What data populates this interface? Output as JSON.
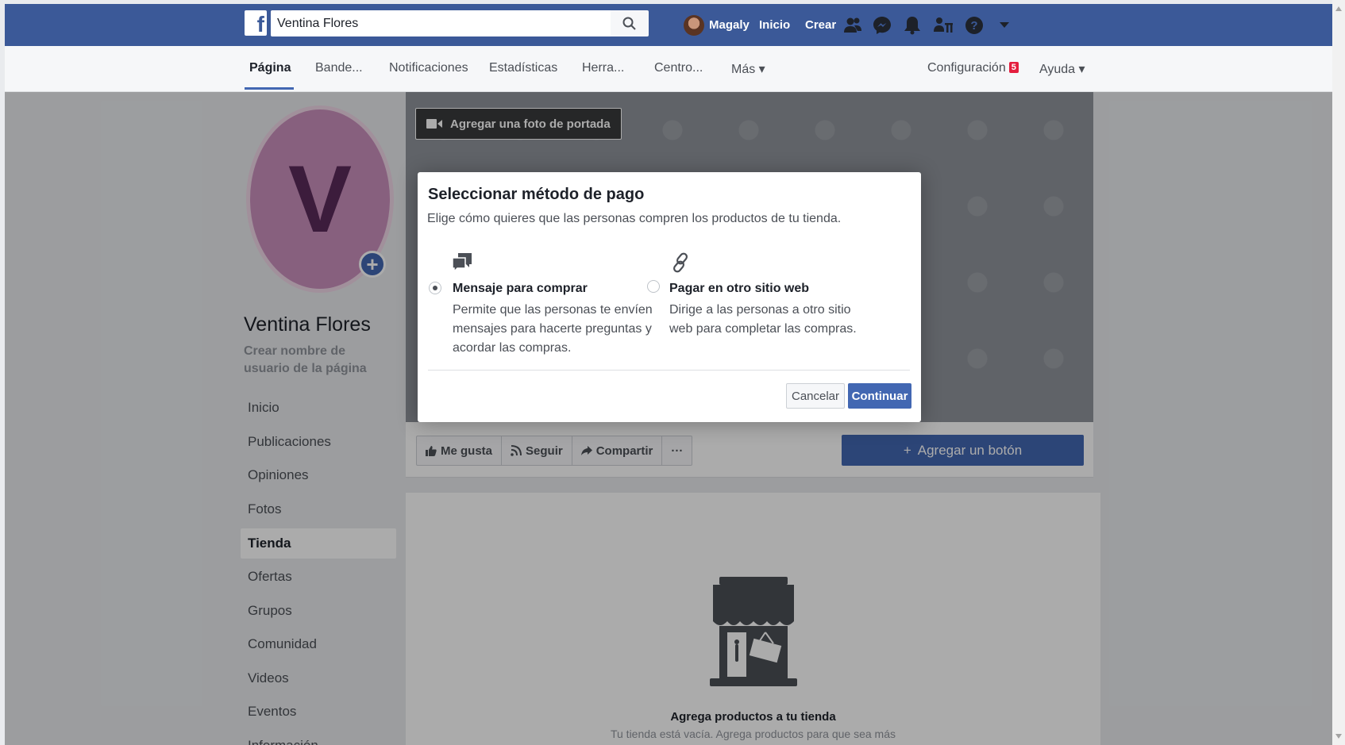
{
  "topbar": {
    "search_value": "Ventina Flores",
    "user_name": "Magaly",
    "nav_home": "Inicio",
    "nav_create": "Crear"
  },
  "pagenav": {
    "items": [
      "Página",
      "Bande...",
      "Notificaciones",
      "Estadísticas",
      "Herra...",
      "Centro...",
      "Más ▾"
    ],
    "settings": "Configuración",
    "settings_badge": "5",
    "help": "Ayuda ▾"
  },
  "profile": {
    "initial": "V",
    "name": "Ventina Flores",
    "username_cta": "Crear nombre de usuario de la página"
  },
  "sidebar": {
    "items": [
      "Inicio",
      "Publicaciones",
      "Opiniones",
      "Fotos",
      "Tienda",
      "Ofertas",
      "Grupos",
      "Comunidad",
      "Videos",
      "Eventos",
      "Información"
    ],
    "active": "Tienda"
  },
  "cover": {
    "add_cover_label": "Agregar una foto de portada"
  },
  "actions": {
    "like": "Me gusta",
    "follow": "Seguir",
    "share": "Compartir",
    "more": "···",
    "add_button": "Agregar un botón"
  },
  "shop": {
    "title": "Agrega productos a tu tienda",
    "subtitle": "Tu tienda está vacía. Agrega productos para que sea más"
  },
  "modal": {
    "title": "Seleccionar método de pago",
    "subtitle": "Elige cómo quieres que las personas compren los productos de tu tienda.",
    "option1": {
      "title": "Mensaje para comprar",
      "desc1": "Permite que las personas te envíen",
      "desc2": "mensajes para hacerte preguntas y",
      "desc3": "acordar las compras.",
      "selected": true
    },
    "option2": {
      "title": "Pagar en otro sitio web",
      "desc1": "Dirige a las personas a otro sitio",
      "desc2": "web para completar las compras.",
      "selected": false
    },
    "cancel": "Cancelar",
    "continue": "Continuar"
  },
  "colors": {
    "brand": "#3b5998",
    "primary_button": "#4267b2",
    "badge": "#e41e3f"
  }
}
